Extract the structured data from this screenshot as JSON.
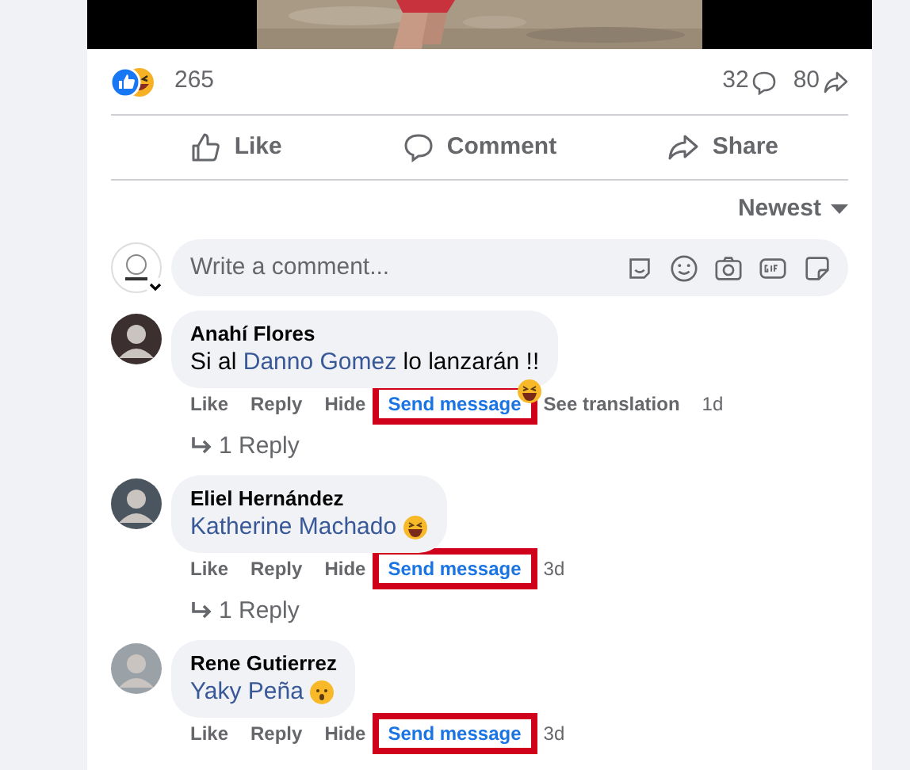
{
  "post": {
    "reactions": {
      "count": "265"
    },
    "comments_count": "32",
    "shares_count": "80"
  },
  "actions": [
    {
      "kind": "like",
      "label": "Like"
    },
    {
      "kind": "comment",
      "label": "Comment"
    },
    {
      "kind": "share",
      "label": "Share"
    }
  ],
  "sort": {
    "label": "Newest"
  },
  "composer": {
    "placeholder": "Write a comment..."
  },
  "comments": [
    {
      "author": "Anahí Flores",
      "body": [
        {
          "kind": "text",
          "text": "Si al "
        },
        {
          "kind": "mention",
          "text": "Danno Gomez"
        },
        {
          "kind": "text",
          "text": " lo lanzarán !!"
        }
      ],
      "reaction": true,
      "links": [
        {
          "kind": "link",
          "label": "Like",
          "highlighted": false
        },
        {
          "kind": "link",
          "label": "Reply",
          "highlighted": false
        },
        {
          "kind": "link",
          "label": "Hide",
          "highlighted": false
        },
        {
          "kind": "send",
          "label": "Send message",
          "highlighted": true
        },
        {
          "kind": "link",
          "label": "See translation",
          "highlighted": false
        },
        {
          "kind": "time",
          "label": "1d",
          "highlighted": false
        }
      ],
      "replies": "1 Reply"
    },
    {
      "author": "Eliel Hernández",
      "body": [
        {
          "kind": "mention",
          "text": "Katherine Machado"
        },
        {
          "kind": "laugh_emoji"
        }
      ],
      "links": [
        {
          "kind": "link",
          "label": "Like",
          "highlighted": false
        },
        {
          "kind": "link",
          "label": "Reply",
          "highlighted": false
        },
        {
          "kind": "link",
          "label": "Hide",
          "highlighted": false
        },
        {
          "kind": "send",
          "label": "Send message",
          "highlighted": true
        },
        {
          "kind": "time",
          "label": "3d",
          "highlighted": false
        }
      ],
      "replies": "1 Reply"
    },
    {
      "author": "Rene Gutierrez",
      "body": [
        {
          "kind": "mention",
          "text": "Yaky Peña"
        },
        {
          "kind": "hushed_emoji"
        }
      ],
      "links": [
        {
          "kind": "link",
          "label": "Like",
          "highlighted": false
        },
        {
          "kind": "link",
          "label": "Reply",
          "highlighted": false
        },
        {
          "kind": "link",
          "label": "Hide",
          "highlighted": false
        },
        {
          "kind": "send",
          "label": "Send message",
          "highlighted": true
        },
        {
          "kind": "time",
          "label": "3d",
          "highlighted": false
        }
      ]
    }
  ]
}
